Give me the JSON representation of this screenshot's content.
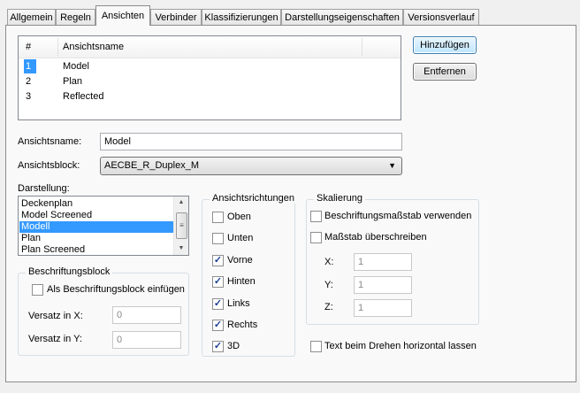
{
  "tabs": [
    "Allgemein",
    "Regeln",
    "Ansichten",
    "Verbinder",
    "Klassifizierungen",
    "Darstellungseigenschaften",
    "Versionsverlauf"
  ],
  "views_list": {
    "col_num": "#",
    "col_name": "Ansichtsname",
    "rows": [
      {
        "num": "1",
        "name": "Model"
      },
      {
        "num": "2",
        "name": "Plan"
      },
      {
        "num": "3",
        "name": "Reflected"
      }
    ]
  },
  "buttons": {
    "add": "Hinzufügen",
    "remove": "Entfernen"
  },
  "view_name": {
    "label": "Ansichtsname:",
    "value": "Model"
  },
  "view_block": {
    "label": "Ansichtsblock:",
    "value": "AECBE_R_Duplex_M"
  },
  "display": {
    "label": "Darstellung:",
    "items": [
      "Deckenplan",
      "Model Screened",
      "Modell",
      "Plan",
      "Plan Screened"
    ],
    "selected": "Modell"
  },
  "annotation_block": {
    "title": "Beschriftungsblock",
    "insert_label": "Als Beschriftungsblock einfügen",
    "insert_checked": false,
    "offset_x_label": "Versatz in X:",
    "offset_x_value": "0",
    "offset_y_label": "Versatz in Y:",
    "offset_y_value": "0"
  },
  "view_directions": {
    "title": "Ansichtsrichtungen",
    "items": [
      {
        "label": "Oben",
        "checked": false
      },
      {
        "label": "Unten",
        "checked": false
      },
      {
        "label": "Vorne",
        "checked": true
      },
      {
        "label": "Hinten",
        "checked": true
      },
      {
        "label": "Links",
        "checked": true
      },
      {
        "label": "Rechts",
        "checked": true
      },
      {
        "label": "3D",
        "checked": true
      }
    ]
  },
  "scaling": {
    "title": "Skalierung",
    "use_annotation_scale": "Beschriftungsmaßstab verwenden",
    "override_scale": "Maßstab überschreiben",
    "x_label": "X:",
    "x_value": "1",
    "y_label": "Y:",
    "y_value": "1",
    "z_label": "Z:",
    "z_value": "1"
  },
  "keep_text_horizontal": "Text beim Drehen horizontal lassen",
  "colors": {
    "selection": "#3399ff",
    "button_border": "#3c7fb1",
    "check": "#1c3f95"
  }
}
